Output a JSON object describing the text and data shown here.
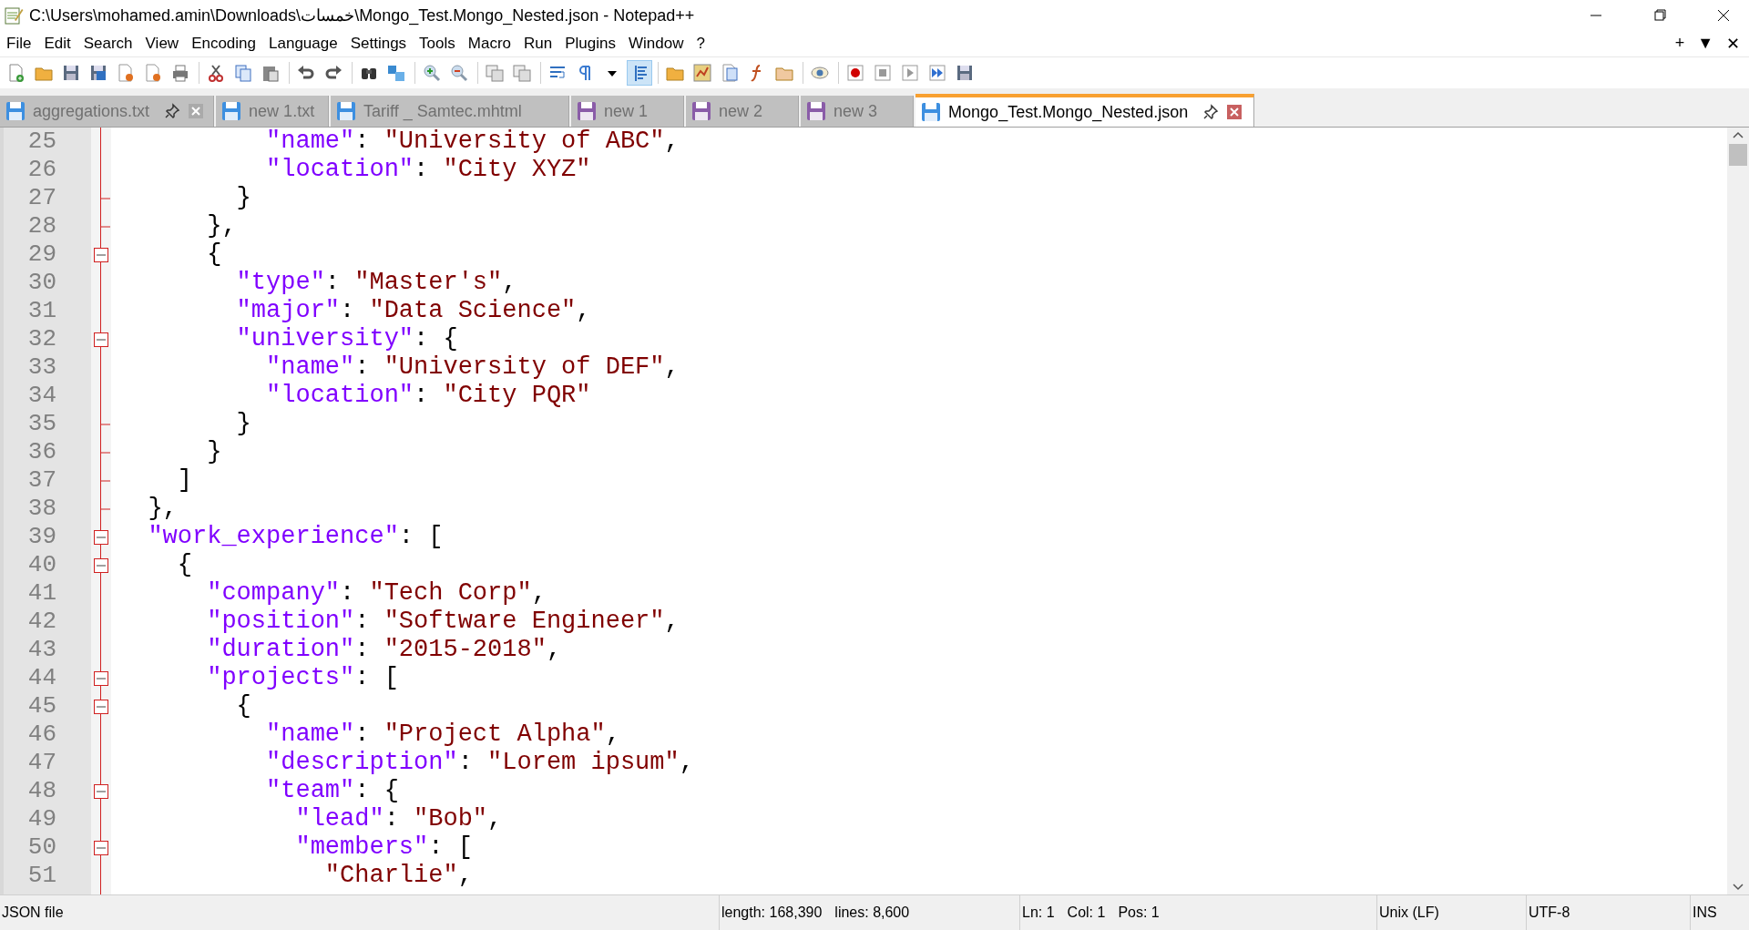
{
  "window": {
    "title": "C:\\Users\\mohamed.amin\\Downloads\\خمسات\\Mongo_Test.Mongo_Nested.json - Notepad++"
  },
  "menu": [
    "File",
    "Edit",
    "Search",
    "View",
    "Encoding",
    "Language",
    "Settings",
    "Tools",
    "Macro",
    "Run",
    "Plugins",
    "Window",
    "?"
  ],
  "menu_right": [
    "+",
    "▼",
    "✕"
  ],
  "toolbar_buttons": [
    {
      "selected": false
    },
    {
      "selected": false
    },
    {
      "selected": false
    },
    {
      "selected": false
    },
    {
      "selected": false
    },
    {
      "selected": false
    },
    {
      "selected": false
    },
    {
      "selected": false
    },
    {
      "selected": false
    },
    {
      "selected": false
    },
    {
      "selected": false
    },
    {
      "selected": false
    },
    {
      "selected": false
    },
    {
      "selected": false
    },
    {
      "selected": false
    },
    {
      "selected": false
    },
    {
      "selected": false
    },
    {
      "selected": false
    },
    {
      "selected": false
    },
    {
      "selected": false
    },
    {
      "selected": false
    },
    {
      "selected": true
    },
    {
      "selected": false
    },
    {
      "selected": false
    },
    {
      "selected": false
    },
    {
      "selected": false
    },
    {
      "selected": false
    },
    {
      "selected": false
    },
    {
      "selected": false
    },
    {
      "selected": false
    },
    {
      "selected": false
    },
    {
      "selected": false
    },
    {
      "selected": false
    }
  ],
  "tabs": [
    {
      "label": "aggregations.txt",
      "selected": false,
      "color": "#3d8fe0",
      "pin": true,
      "close": true
    },
    {
      "label": "new 1.txt",
      "selected": false,
      "color": "#3d8fe0",
      "pin": false,
      "close": false
    },
    {
      "label": "Tariff _ Samtec.mhtml",
      "selected": false,
      "color": "#3d8fe0",
      "pin": false,
      "close": false
    },
    {
      "label": "new 1",
      "selected": false,
      "color": "#8a5ca8",
      "pin": false,
      "close": false
    },
    {
      "label": "new 2",
      "selected": false,
      "color": "#8a5ca8",
      "pin": false,
      "close": false
    },
    {
      "label": "new 3",
      "selected": false,
      "color": "#8a5ca8",
      "pin": false,
      "close": false
    },
    {
      "label": "Mongo_Test.Mongo_Nested.json",
      "selected": true,
      "color": "#3d8fe0",
      "pin": true,
      "close": true
    }
  ],
  "lines": [
    {
      "number": "25",
      "kind": "plain",
      "tokens": [
        {
          "kind": "key",
          "text": "          \"name\""
        },
        {
          "kind": "punct",
          "text": ": "
        },
        {
          "kind": "string",
          "text": "\"University of ABC\""
        },
        {
          "kind": "punct",
          "text": ","
        }
      ]
    },
    {
      "number": "26",
      "kind": "plain",
      "tokens": [
        {
          "kind": "key",
          "text": "          \"location\""
        },
        {
          "kind": "punct",
          "text": ": "
        },
        {
          "kind": "string",
          "text": "\"City XYZ\""
        }
      ]
    },
    {
      "number": "27",
      "kind": "fold-end",
      "tokens": [
        {
          "kind": "punct",
          "text": "        }"
        }
      ]
    },
    {
      "number": "28",
      "kind": "fold-end",
      "tokens": [
        {
          "kind": "punct",
          "text": "      },"
        }
      ]
    },
    {
      "number": "29",
      "kind": "fold-start",
      "tokens": [
        {
          "kind": "punct",
          "text": "      {"
        }
      ]
    },
    {
      "number": "30",
      "kind": "plain",
      "tokens": [
        {
          "kind": "key",
          "text": "        \"type\""
        },
        {
          "kind": "punct",
          "text": ": "
        },
        {
          "kind": "string",
          "text": "\"Master's\""
        },
        {
          "kind": "punct",
          "text": ","
        }
      ]
    },
    {
      "number": "31",
      "kind": "plain",
      "tokens": [
        {
          "kind": "key",
          "text": "        \"major\""
        },
        {
          "kind": "punct",
          "text": ": "
        },
        {
          "kind": "string",
          "text": "\"Data Science\""
        },
        {
          "kind": "punct",
          "text": ","
        }
      ]
    },
    {
      "number": "32",
      "kind": "fold-start",
      "tokens": [
        {
          "kind": "key",
          "text": "        \"university\""
        },
        {
          "kind": "punct",
          "text": ": {"
        }
      ]
    },
    {
      "number": "33",
      "kind": "plain",
      "tokens": [
        {
          "kind": "key",
          "text": "          \"name\""
        },
        {
          "kind": "punct",
          "text": ": "
        },
        {
          "kind": "string",
          "text": "\"University of DEF\""
        },
        {
          "kind": "punct",
          "text": ","
        }
      ]
    },
    {
      "number": "34",
      "kind": "plain",
      "tokens": [
        {
          "kind": "key",
          "text": "          \"location\""
        },
        {
          "kind": "punct",
          "text": ": "
        },
        {
          "kind": "string",
          "text": "\"City PQR\""
        }
      ]
    },
    {
      "number": "35",
      "kind": "fold-end",
      "tokens": [
        {
          "kind": "punct",
          "text": "        }"
        }
      ]
    },
    {
      "number": "36",
      "kind": "fold-end",
      "tokens": [
        {
          "kind": "punct",
          "text": "      }"
        }
      ]
    },
    {
      "number": "37",
      "kind": "fold-end",
      "tokens": [
        {
          "kind": "punct",
          "text": "    ]"
        }
      ]
    },
    {
      "number": "38",
      "kind": "fold-end",
      "tokens": [
        {
          "kind": "punct",
          "text": "  },"
        }
      ]
    },
    {
      "number": "39",
      "kind": "fold-start",
      "tokens": [
        {
          "kind": "key",
          "text": "  \"work_experience\""
        },
        {
          "kind": "punct",
          "text": ": ["
        }
      ]
    },
    {
      "number": "40",
      "kind": "fold-start",
      "tokens": [
        {
          "kind": "punct",
          "text": "    {"
        }
      ]
    },
    {
      "number": "41",
      "kind": "plain",
      "tokens": [
        {
          "kind": "key",
          "text": "      \"company\""
        },
        {
          "kind": "punct",
          "text": ": "
        },
        {
          "kind": "string",
          "text": "\"Tech Corp\""
        },
        {
          "kind": "punct",
          "text": ","
        }
      ]
    },
    {
      "number": "42",
      "kind": "plain",
      "tokens": [
        {
          "kind": "key",
          "text": "      \"position\""
        },
        {
          "kind": "punct",
          "text": ": "
        },
        {
          "kind": "string",
          "text": "\"Software Engineer\""
        },
        {
          "kind": "punct",
          "text": ","
        }
      ]
    },
    {
      "number": "43",
      "kind": "plain",
      "tokens": [
        {
          "kind": "key",
          "text": "      \"duration\""
        },
        {
          "kind": "punct",
          "text": ": "
        },
        {
          "kind": "string",
          "text": "\"2015-2018\""
        },
        {
          "kind": "punct",
          "text": ","
        }
      ]
    },
    {
      "number": "44",
      "kind": "fold-start",
      "tokens": [
        {
          "kind": "key",
          "text": "      \"projects\""
        },
        {
          "kind": "punct",
          "text": ": ["
        }
      ]
    },
    {
      "number": "45",
      "kind": "fold-start",
      "tokens": [
        {
          "kind": "punct",
          "text": "        {"
        }
      ]
    },
    {
      "number": "46",
      "kind": "plain",
      "tokens": [
        {
          "kind": "key",
          "text": "          \"name\""
        },
        {
          "kind": "punct",
          "text": ": "
        },
        {
          "kind": "string",
          "text": "\"Project Alpha\""
        },
        {
          "kind": "punct",
          "text": ","
        }
      ]
    },
    {
      "number": "47",
      "kind": "plain",
      "tokens": [
        {
          "kind": "key",
          "text": "          \"description\""
        },
        {
          "kind": "punct",
          "text": ": "
        },
        {
          "kind": "string",
          "text": "\"Lorem ipsum\""
        },
        {
          "kind": "punct",
          "text": ","
        }
      ]
    },
    {
      "number": "48",
      "kind": "fold-start",
      "tokens": [
        {
          "kind": "key",
          "text": "          \"team\""
        },
        {
          "kind": "punct",
          "text": ": {"
        }
      ]
    },
    {
      "number": "49",
      "kind": "plain",
      "tokens": [
        {
          "kind": "key",
          "text": "            \"lead\""
        },
        {
          "kind": "punct",
          "text": ": "
        },
        {
          "kind": "string",
          "text": "\"Bob\""
        },
        {
          "kind": "punct",
          "text": ","
        }
      ]
    },
    {
      "number": "50",
      "kind": "fold-start",
      "tokens": [
        {
          "kind": "key",
          "text": "            \"members\""
        },
        {
          "kind": "punct",
          "text": ": ["
        }
      ]
    },
    {
      "number": "51",
      "kind": "plain",
      "tokens": [
        {
          "kind": "string",
          "text": "              \"Charlie\""
        },
        {
          "kind": "punct",
          "text": ","
        }
      ]
    }
  ],
  "status_bar": {
    "file_type": "JSON file",
    "length": "length: 168,390",
    "lines": "lines: 8,600",
    "ln": "Ln: 1",
    "col": "Col: 1",
    "pos": "Pos: 1",
    "eol": "Unix (LF)",
    "encoding": "UTF-8",
    "mode": "INS"
  }
}
